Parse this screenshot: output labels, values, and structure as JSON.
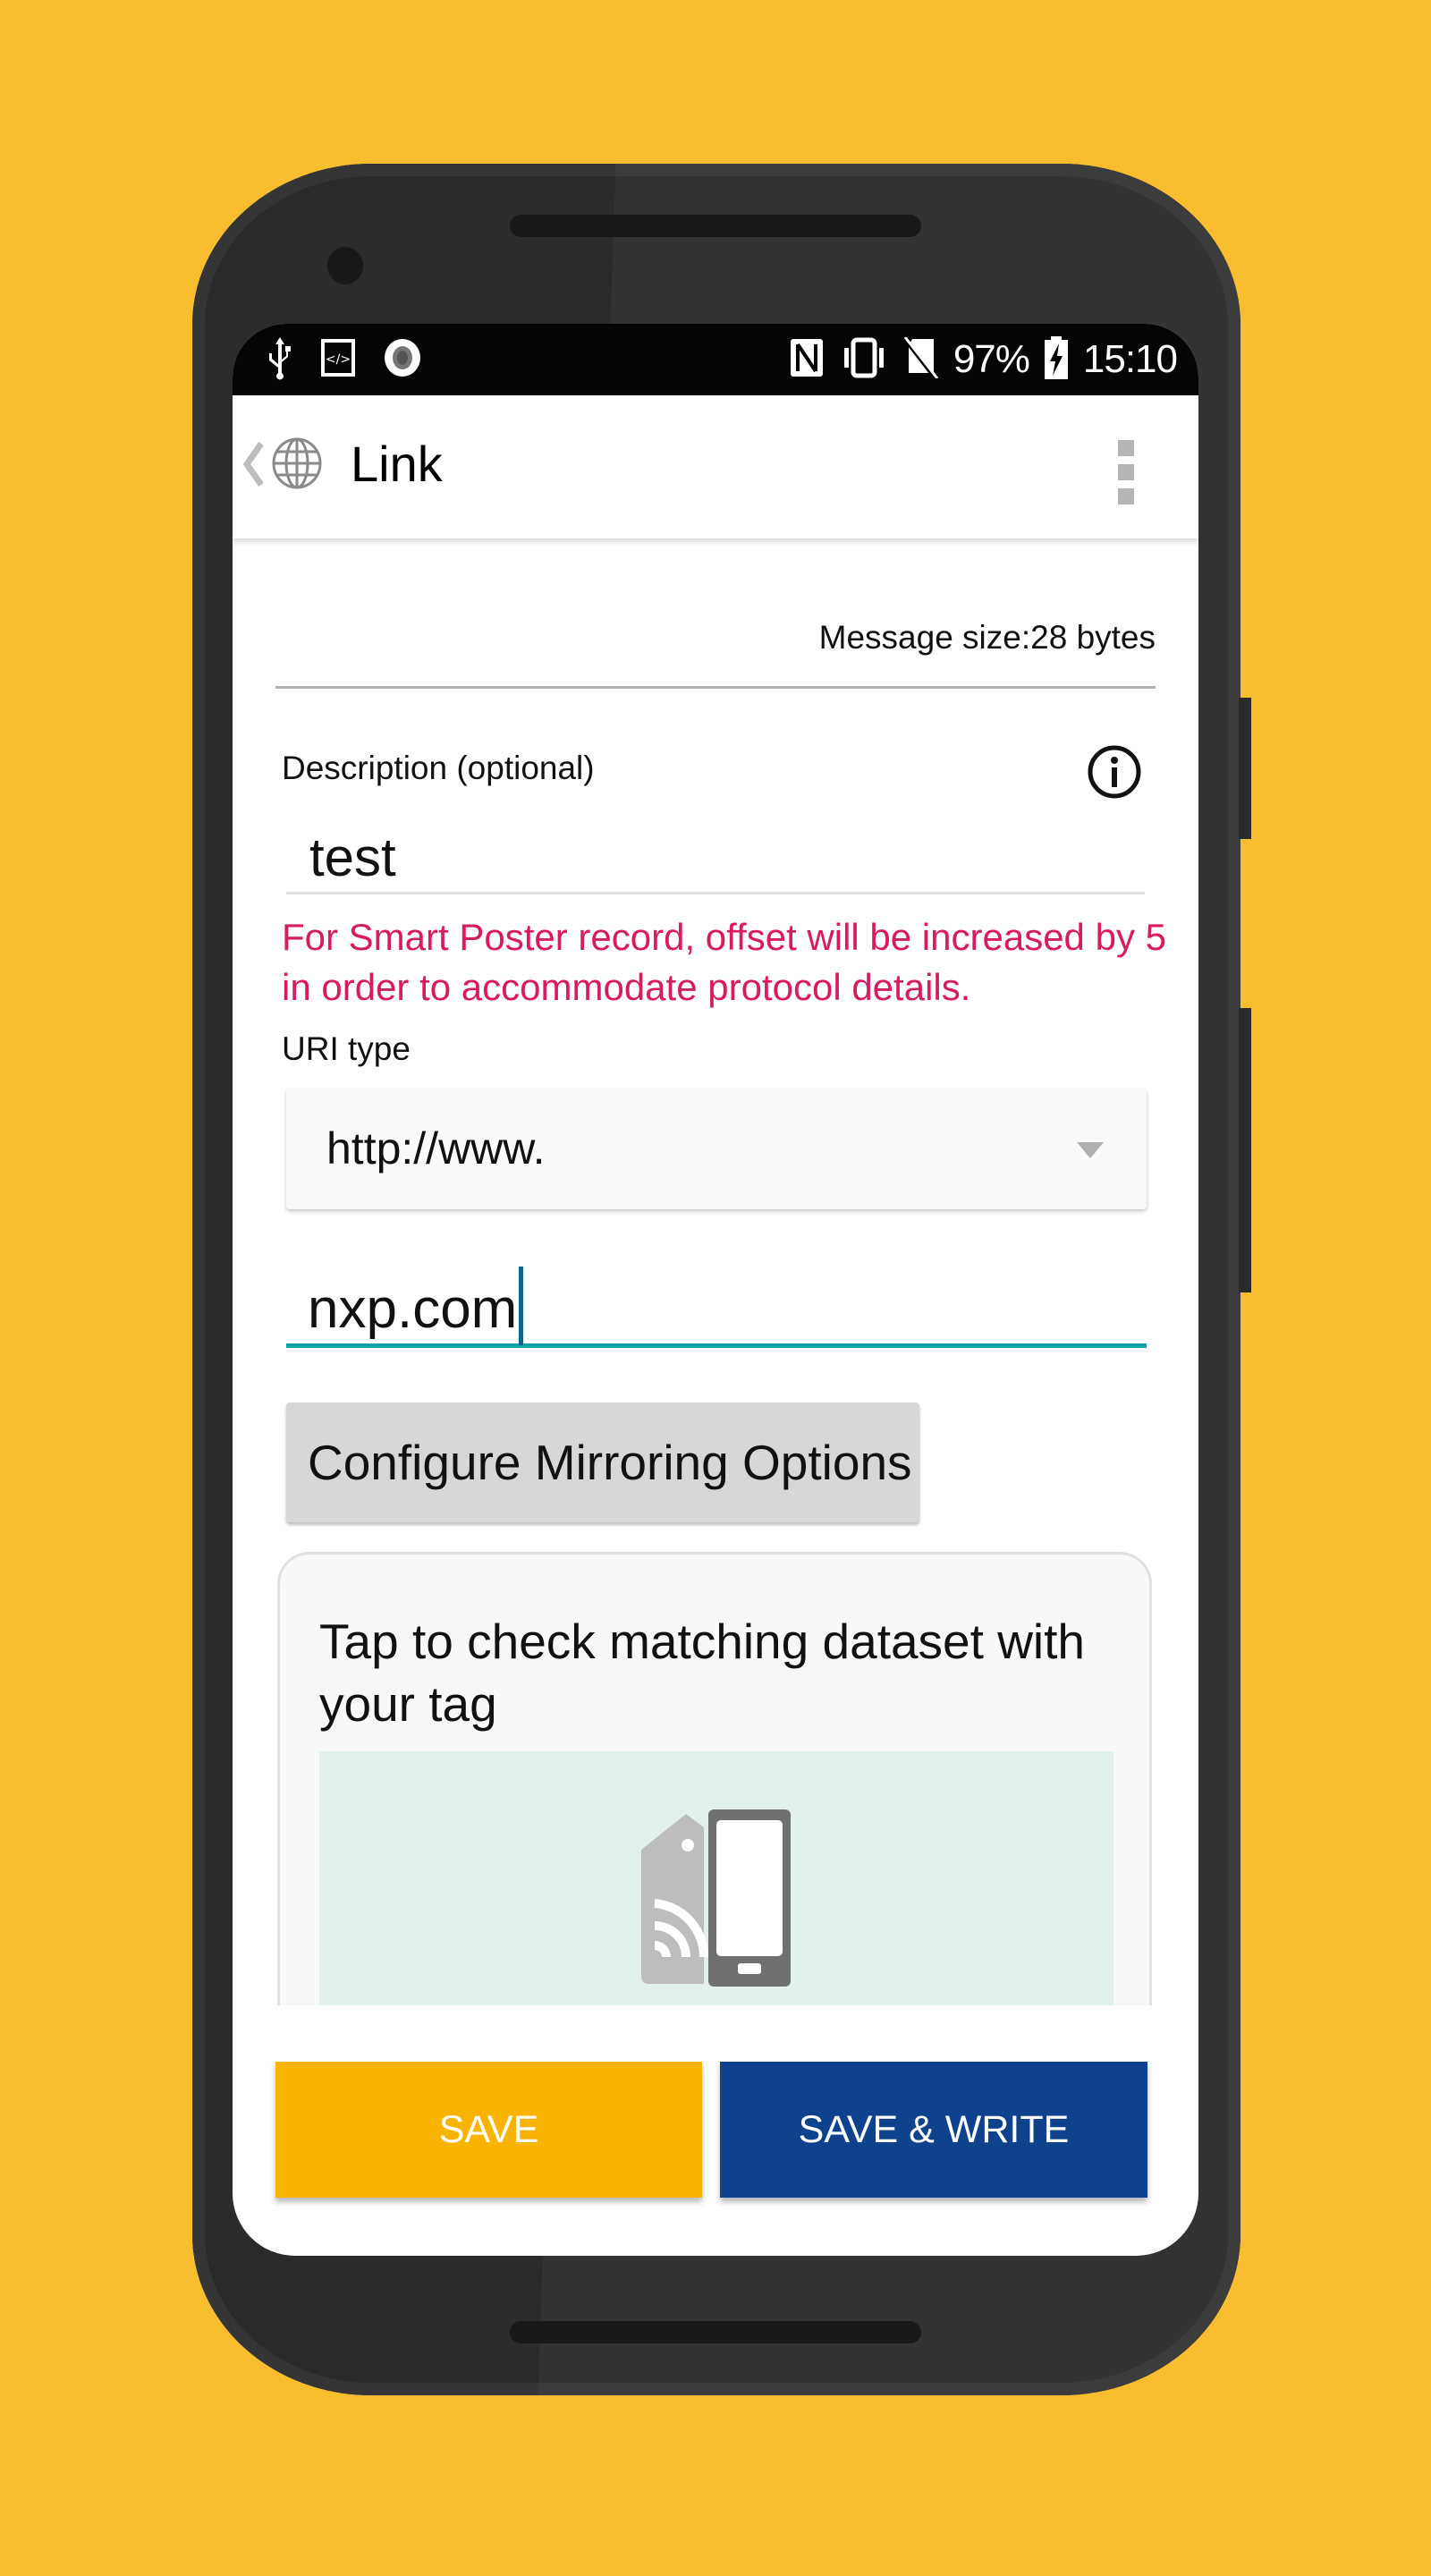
{
  "status_bar": {
    "left_icons": [
      "usb-icon",
      "developer-code-icon",
      "record-circle-icon"
    ],
    "right_icons": [
      "nfc-icon",
      "vibrate-icon",
      "no-sim-icon"
    ],
    "battery_percent": "97%",
    "battery_icon": "battery-charging-icon",
    "time": "15:10"
  },
  "app_bar": {
    "back_icon": "chevron-left-icon",
    "app_icon": "globe-icon",
    "title": "Link",
    "menu_icon": "overflow-menu-icon"
  },
  "form": {
    "message_size": "Message size:28 bytes",
    "description_label": "Description (optional)",
    "description_value": "test",
    "info_icon": "info-icon",
    "warning_text": "For Smart Poster record, offset will be increased by 5 in order to accommodate protocol details.",
    "uri_type_label": "URI type",
    "uri_type_selected": "http://www.",
    "url_value": "nxp.com",
    "mirror_button": "Configure Mirroring Options"
  },
  "check_card": {
    "title": "Tap to check matching dataset with your tag",
    "illustration": "nfc-tag-phone-icon"
  },
  "actions": {
    "save": "SAVE",
    "save_write": "SAVE & WRITE"
  },
  "colors": {
    "background": "#f8be2f",
    "warning": "#d81b60",
    "focus_underline": "#12a3a6",
    "save_button": "#f8b400",
    "save_write_button": "#0e428c"
  }
}
